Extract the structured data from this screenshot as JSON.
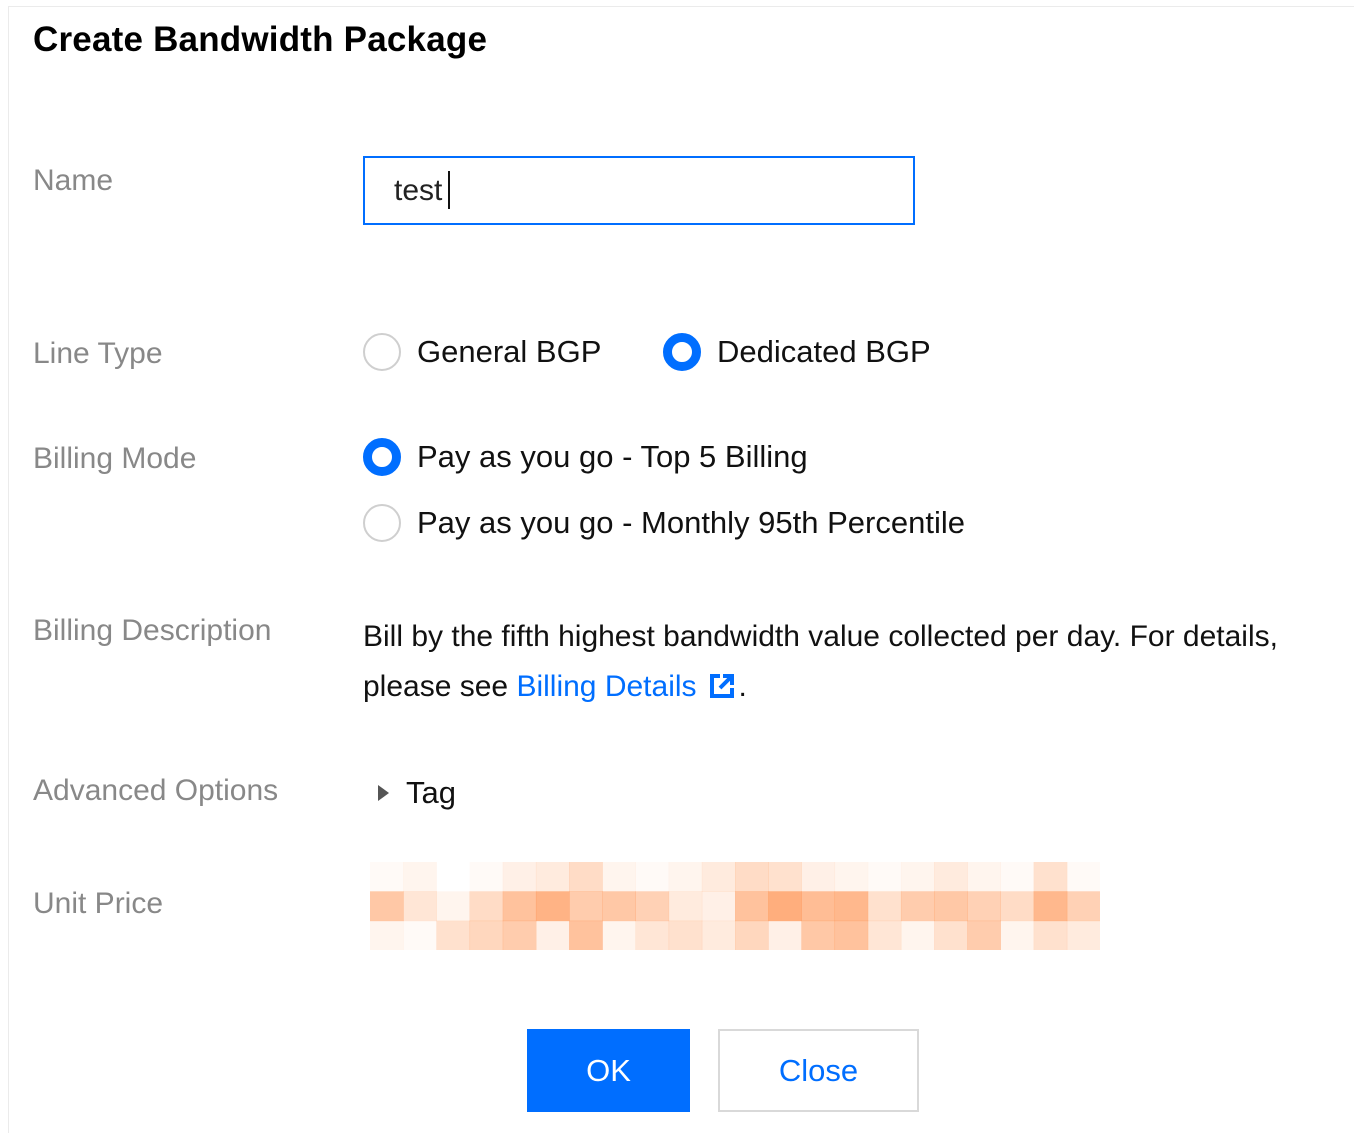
{
  "dialog": {
    "title": "Create Bandwidth Package"
  },
  "form": {
    "name": {
      "label": "Name",
      "value": "test"
    },
    "line_type": {
      "label": "Line Type",
      "options": [
        {
          "label": "General BGP",
          "checked": false
        },
        {
          "label": "Dedicated BGP",
          "checked": true
        }
      ]
    },
    "billing_mode": {
      "label": "Billing Mode",
      "options": [
        {
          "label": "Pay as you go - Top 5 Billing",
          "checked": true
        },
        {
          "label": "Pay as you go - Monthly 95th Percentile",
          "checked": false
        }
      ]
    },
    "billing_description": {
      "label": "Billing Description",
      "text_before": "Bill by the fifth highest bandwidth value collected per day. For details, please see ",
      "link_text": "Billing Details",
      "text_after": "."
    },
    "advanced_options": {
      "label": "Advanced Options",
      "tag_label": "Tag"
    },
    "unit_price": {
      "label": "Unit Price"
    }
  },
  "buttons": {
    "ok": "OK",
    "close": "Close"
  },
  "colors": {
    "accent": "#006eff",
    "label": "#888888",
    "blur_orange": "#ff9a5c"
  },
  "icons": {
    "external_link": "external-link-icon",
    "expand": "caret-right-icon"
  }
}
